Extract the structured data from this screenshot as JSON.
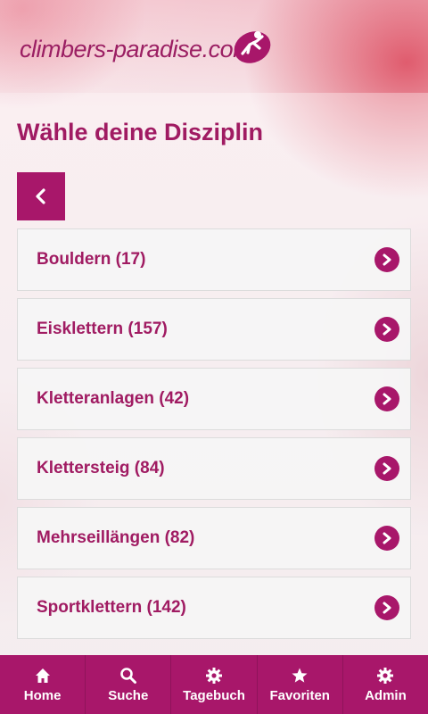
{
  "brand": {
    "logo_text": "climbers-paradise.com",
    "accent_color": "#a8176a",
    "title_color": "#a01b62"
  },
  "page": {
    "title": "Wähle deine Disziplin"
  },
  "disciplines": [
    {
      "label": "Bouldern (17)"
    },
    {
      "label": "Eisklettern (157)"
    },
    {
      "label": "Kletteranlagen (42)"
    },
    {
      "label": "Klettersteig (84)"
    },
    {
      "label": "Mehrseillängen (82)"
    },
    {
      "label": "Sportklettern (142)"
    }
  ],
  "tabbar": {
    "items": [
      {
        "label": "Home",
        "icon": "home-icon"
      },
      {
        "label": "Suche",
        "icon": "search-icon"
      },
      {
        "label": "Tagebuch",
        "icon": "gear-icon"
      },
      {
        "label": "Favoriten",
        "icon": "star-icon"
      },
      {
        "label": "Admin",
        "icon": "gear-icon"
      }
    ]
  }
}
